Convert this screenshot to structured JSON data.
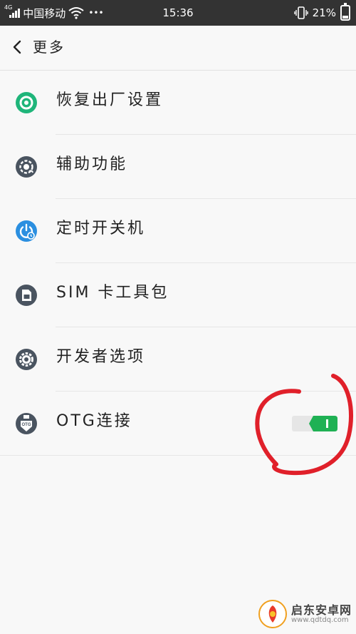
{
  "status_bar": {
    "network_type": "4G",
    "carrier": "中国移动",
    "more": "•••",
    "time": "15:36",
    "battery": "21%",
    "battery_level": 0.21
  },
  "header": {
    "title": "更多"
  },
  "items": [
    {
      "label": "恢复出厂设置",
      "icon": "restore-icon",
      "icon_color": "#1fb57a"
    },
    {
      "label": "辅助功能",
      "icon": "gear-hand-icon",
      "icon_color": "#4a5460"
    },
    {
      "label": "定时开关机",
      "icon": "timer-power-icon",
      "icon_color": "#2b8fe0"
    },
    {
      "label": "SIM 卡工具包",
      "icon": "sim-card-icon",
      "icon_color": "#4a5460"
    },
    {
      "label": "开发者选项",
      "icon": "gear-icon",
      "icon_color": "#4a5460"
    },
    {
      "label": "OTG连接",
      "icon": "usb-otg-icon",
      "icon_color": "#4a5460",
      "icon_text": "OTG",
      "toggle_on": true
    }
  ],
  "colors": {
    "accent": "#1fb154",
    "annotation": "#e0202a"
  },
  "watermark": {
    "name": "启东安卓网",
    "url": "www.qdtdq.com"
  }
}
